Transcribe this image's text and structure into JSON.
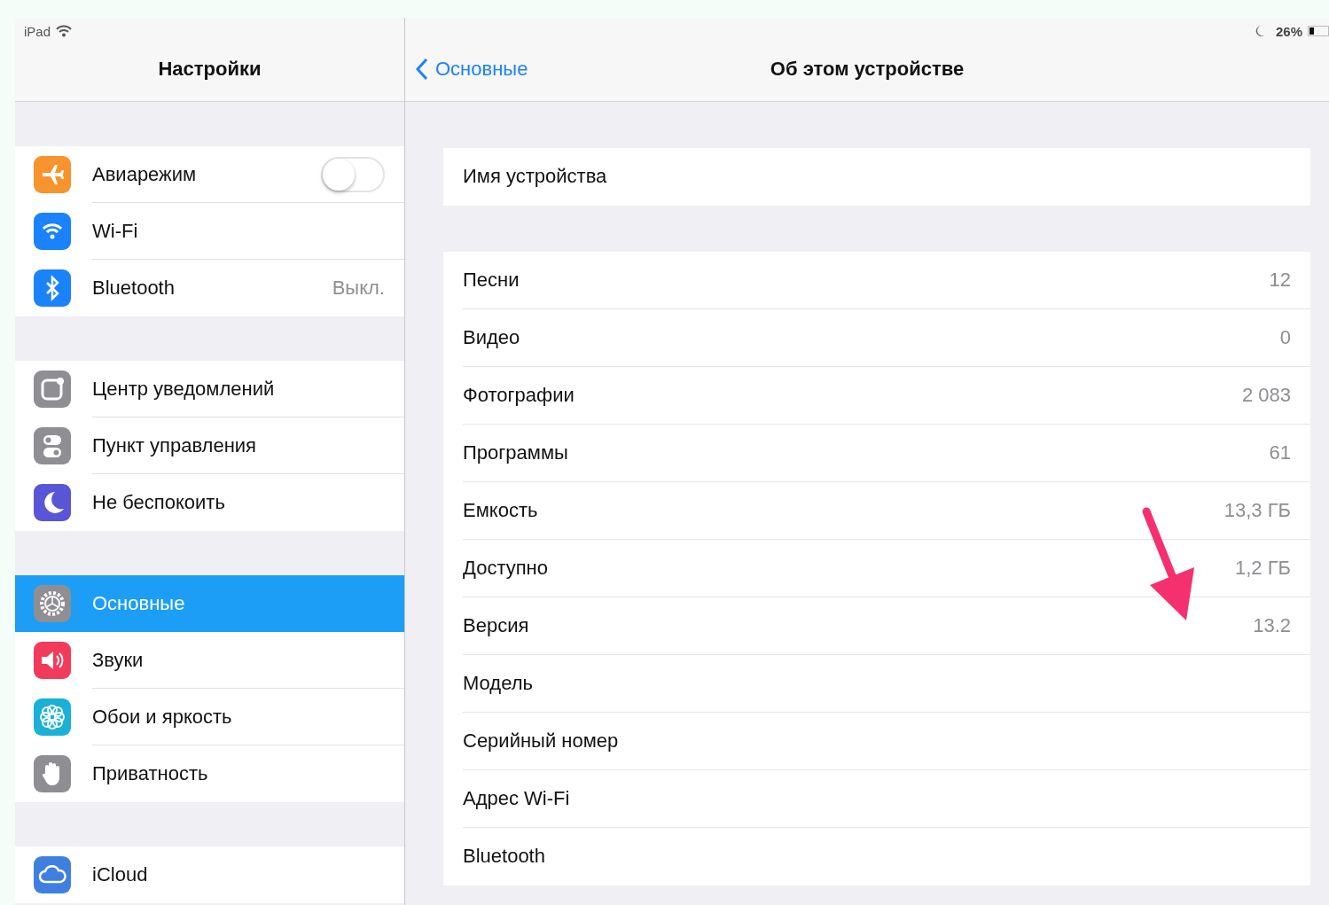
{
  "status_bar": {
    "device": "iPad",
    "battery": "26%"
  },
  "sidebar": {
    "title": "Настройки",
    "groups": [
      {
        "items": [
          {
            "label": "Авиарежим",
            "kind": "toggle",
            "on": false,
            "selected": false,
            "color": "#f7942d"
          },
          {
            "label": "Wi-Fi",
            "kind": "plain",
            "selected": false,
            "color": "#1a82fb"
          },
          {
            "label": "Bluetooth",
            "kind": "value",
            "value": "Выкл.",
            "selected": false,
            "color": "#1a82fb"
          }
        ]
      },
      {
        "items": [
          {
            "label": "Центр уведомлений",
            "kind": "plain",
            "selected": false,
            "color": "#8e8e93"
          },
          {
            "label": "Пункт управления",
            "kind": "plain",
            "selected": false,
            "color": "#8e8e93"
          },
          {
            "label": "Не беспокоить",
            "kind": "plain",
            "selected": false,
            "color": "#5856d6"
          }
        ]
      },
      {
        "items": [
          {
            "label": "Основные",
            "kind": "plain",
            "selected": true,
            "color": "#8e8e93"
          },
          {
            "label": "Звуки",
            "kind": "plain",
            "selected": false,
            "color": "#f23b5a"
          },
          {
            "label": "Обои и яркость",
            "kind": "plain",
            "selected": false,
            "color": "#1bb0d6"
          },
          {
            "label": "Приватность",
            "kind": "plain",
            "selected": false,
            "color": "#8e8e93"
          }
        ]
      },
      {
        "items": [
          {
            "label": "iCloud",
            "kind": "plain",
            "selected": false,
            "color": "#3f7fe0"
          }
        ]
      }
    ]
  },
  "detail": {
    "back": "Основные",
    "title": "Об этом устройстве",
    "groups": [
      {
        "rows": [
          {
            "label": "Имя устройства"
          }
        ]
      },
      {
        "rows": [
          {
            "label": "Песни",
            "value": "12"
          },
          {
            "label": "Видео",
            "value": "0"
          },
          {
            "label": "Фотографии",
            "value": "2 083"
          },
          {
            "label": "Программы",
            "value": "61"
          },
          {
            "label": "Емкость",
            "value": "13,3 ГБ"
          },
          {
            "label": "Доступно",
            "value": "1,2 ГБ"
          },
          {
            "label": "Версия",
            "value": "13.2"
          },
          {
            "label": "Модель"
          },
          {
            "label": "Серийный номер"
          },
          {
            "label": "Адрес Wi-Fi"
          },
          {
            "label": "Bluetooth"
          }
        ]
      }
    ]
  }
}
